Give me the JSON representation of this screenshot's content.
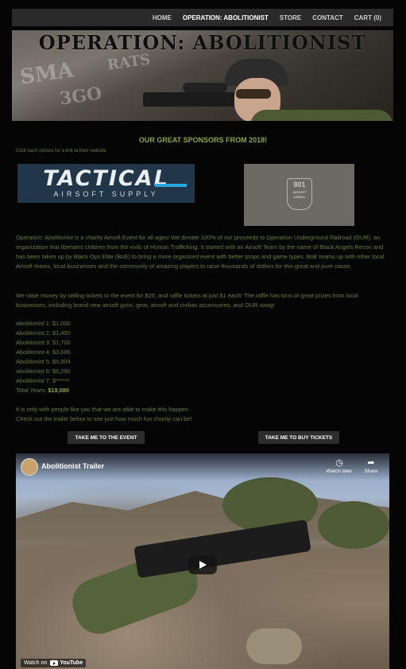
{
  "nav": {
    "items": [
      {
        "label": "HOME",
        "active": false
      },
      {
        "label": "OPERATION: ABOLITIONIST",
        "active": true
      },
      {
        "label": "STORE",
        "active": false
      },
      {
        "label": "CONTACT",
        "active": false
      },
      {
        "label": "CART (0)",
        "active": false
      }
    ]
  },
  "banner": {
    "title": "OPERATION: ABOLITIONIST"
  },
  "sponsors": {
    "heading": "OUR GREAT SPONSORS FROM 2018!",
    "note": "Click each picture for a link to their website",
    "tactical_logo": {
      "big": "TACTICAL",
      "small": "AIRSOFT SUPPLY"
    },
    "logo_801": {
      "big": "801",
      "small": "AIRSOFT ARENA"
    }
  },
  "content": {
    "para1": "Operation: Abolitionist is a charity Airsoft Event for all ages! We donate 100% of our proceeds to Operation Underground Railroad (OUR), an organization that liberates children from the evils of Human Trafficking. It started with an Airsoft Team by the name of Black Angels Recon and has been taken up by Black Ops Elite (BoE) to bring a more organized event with better props and game types. BoE teams up with other local Airsoft teams, local businesses and the community of amazing players to raise thousands of dollars for this great and pure cause.",
    "para2": "We raise money by selling tickets to the event for $25, and raffle tickets at just $1 each! The raffle has tons of great prizes from local businesses, including brand new airsoft guns, gear, airsoft and civilian accessories, and OUR swag!",
    "totals": [
      "Abolitionist 1: $1,000",
      "Abolitionist 2: $1,400",
      "Abolitionist 3: $1,700",
      "Abolitionist 4: $3,686",
      "Abolitionist 5: $5,004",
      "Abolitionist 6: $6,290",
      "Abolitionist 7: $******"
    ],
    "total_years_label": "Total Years: ",
    "total_years_value": "$19,080",
    "para3_line1": "It is only with people like you that we are able to make this happen.",
    "para3_line2": "Check out the trailer below to see just how much fun charity can be!"
  },
  "buttons": {
    "event": "TAKE ME TO THE EVENT",
    "tickets": "TAKE ME TO BUY TICKETS"
  },
  "video": {
    "title": "Abolitionist Trailer",
    "watch_later": "Watch later",
    "share": "Share",
    "watch_on": "Watch on",
    "youtube": "YouTube"
  }
}
